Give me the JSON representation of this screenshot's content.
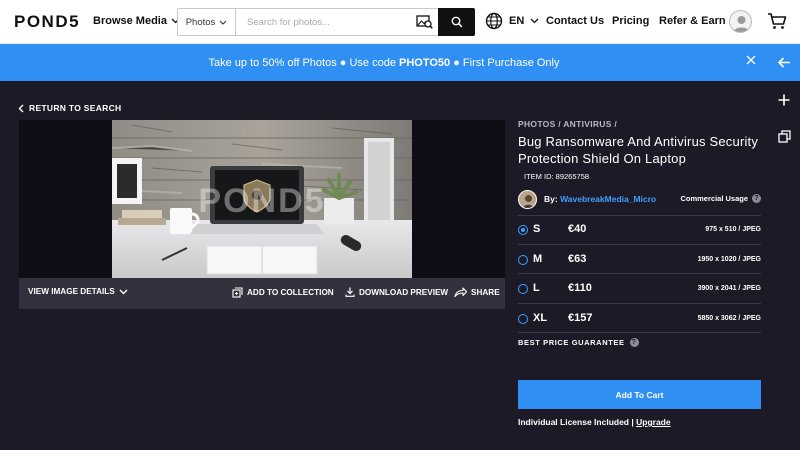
{
  "header": {
    "logo": "POND5",
    "browse_label": "Browse Media",
    "search": {
      "type": "Photos",
      "placeholder": "Search for photos..."
    },
    "language": "EN",
    "nav": [
      "Contact Us",
      "Pricing",
      "Refer & Earn"
    ]
  },
  "promo": {
    "text_before": "Take up to 50% off Photos ● Use code ",
    "code": "PHOTO50",
    "text_after": " ● First Purchase Only"
  },
  "main": {
    "back_label": "RETURN TO SEARCH",
    "preview": {
      "watermark": "POND5"
    },
    "actions": {
      "view_details": "VIEW IMAGE DETAILS",
      "add_to_collection": "ADD TO COLLECTION",
      "download_preview": "DOWNLOAD PREVIEW",
      "share": "SHARE"
    }
  },
  "info": {
    "breadcrumb": "PHOTOS / ANTIVIRUS /",
    "title": "Bug Ransomware And Antivirus Security Protection Shield On Laptop",
    "item_id": "ITEM ID: 89265758",
    "by_label": "By: ",
    "author": "WavebreakMedia_Micro",
    "usage": "Commercial Usage",
    "sizes": [
      {
        "label": "S",
        "price": "€40",
        "dims": "975 x 510 / JPEG",
        "selected": true
      },
      {
        "label": "M",
        "price": "€63",
        "dims": "1950 x 1020 / JPEG",
        "selected": false
      },
      {
        "label": "L",
        "price": "€110",
        "dims": "3900 x 2041 / JPEG",
        "selected": false
      },
      {
        "label": "XL",
        "price": "€157",
        "dims": "5850 x 3062 / JPEG",
        "selected": false
      }
    ],
    "guarantee": "BEST PRICE GUARANTEE",
    "cart_button": "Add To Cart",
    "license_text": "Individual License Included | ",
    "upgrade": "Upgrade"
  },
  "colors": {
    "accent": "#2f8ff2",
    "dark_bg": "#1c1a27",
    "link": "#3fa0ff"
  },
  "icons": [
    "chevron-down-icon",
    "visual-search-icon",
    "search-icon",
    "globe-icon",
    "user-icon",
    "cart-icon",
    "close-icon",
    "arrow-left-icon",
    "plus-icon",
    "copy-icon",
    "collection-icon",
    "download-icon",
    "share-icon",
    "help-icon"
  ]
}
